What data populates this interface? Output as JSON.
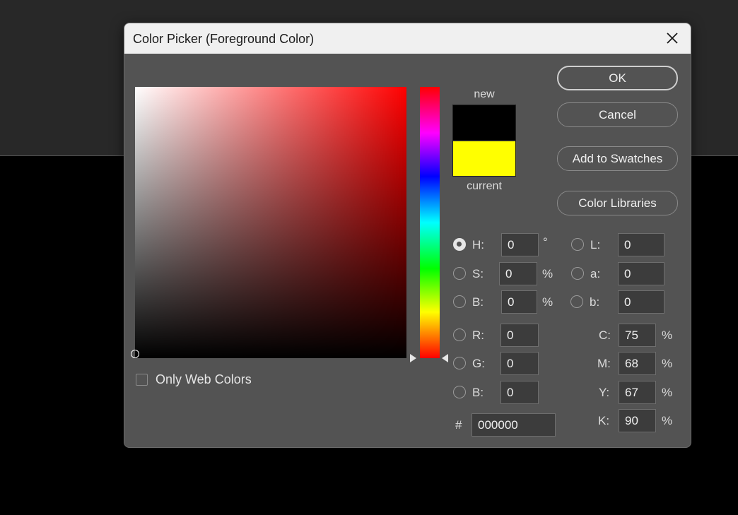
{
  "dialog": {
    "title": "Color Picker (Foreground Color)"
  },
  "swatches": {
    "new_label": "new",
    "current_label": "current",
    "new_color": "#000000",
    "current_color": "#ffff00"
  },
  "buttons": {
    "ok": "OK",
    "cancel": "Cancel",
    "add_to_swatches": "Add to Swatches",
    "color_libraries": "Color Libraries"
  },
  "hsb": {
    "h_label": "H:",
    "h_value": "0",
    "h_unit": "°",
    "s_label": "S:",
    "s_value": "0",
    "s_unit": "%",
    "b_label": "B:",
    "b_value": "0",
    "b_unit": "%",
    "selected": "H"
  },
  "lab": {
    "l_label": "L:",
    "l_value": "0",
    "a_label": "a:",
    "a_value": "0",
    "b_label": "b:",
    "b_value": "0"
  },
  "rgb": {
    "r_label": "R:",
    "r_value": "0",
    "g_label": "G:",
    "g_value": "0",
    "b_label": "B:",
    "b_value": "0"
  },
  "cmyk": {
    "c_label": "C:",
    "c_value": "75",
    "c_unit": "%",
    "m_label": "M:",
    "m_value": "68",
    "m_unit": "%",
    "y_label": "Y:",
    "y_value": "67",
    "y_unit": "%",
    "k_label": "K:",
    "k_value": "90",
    "k_unit": "%"
  },
  "hex": {
    "label": "#",
    "value": "000000"
  },
  "options": {
    "only_web_colors": "Only Web Colors",
    "only_web_colors_checked": false
  },
  "colors": {
    "dialog_bg": "#535353",
    "titlebar_bg": "#f0f0f0",
    "field_hue": "#ff0000"
  }
}
